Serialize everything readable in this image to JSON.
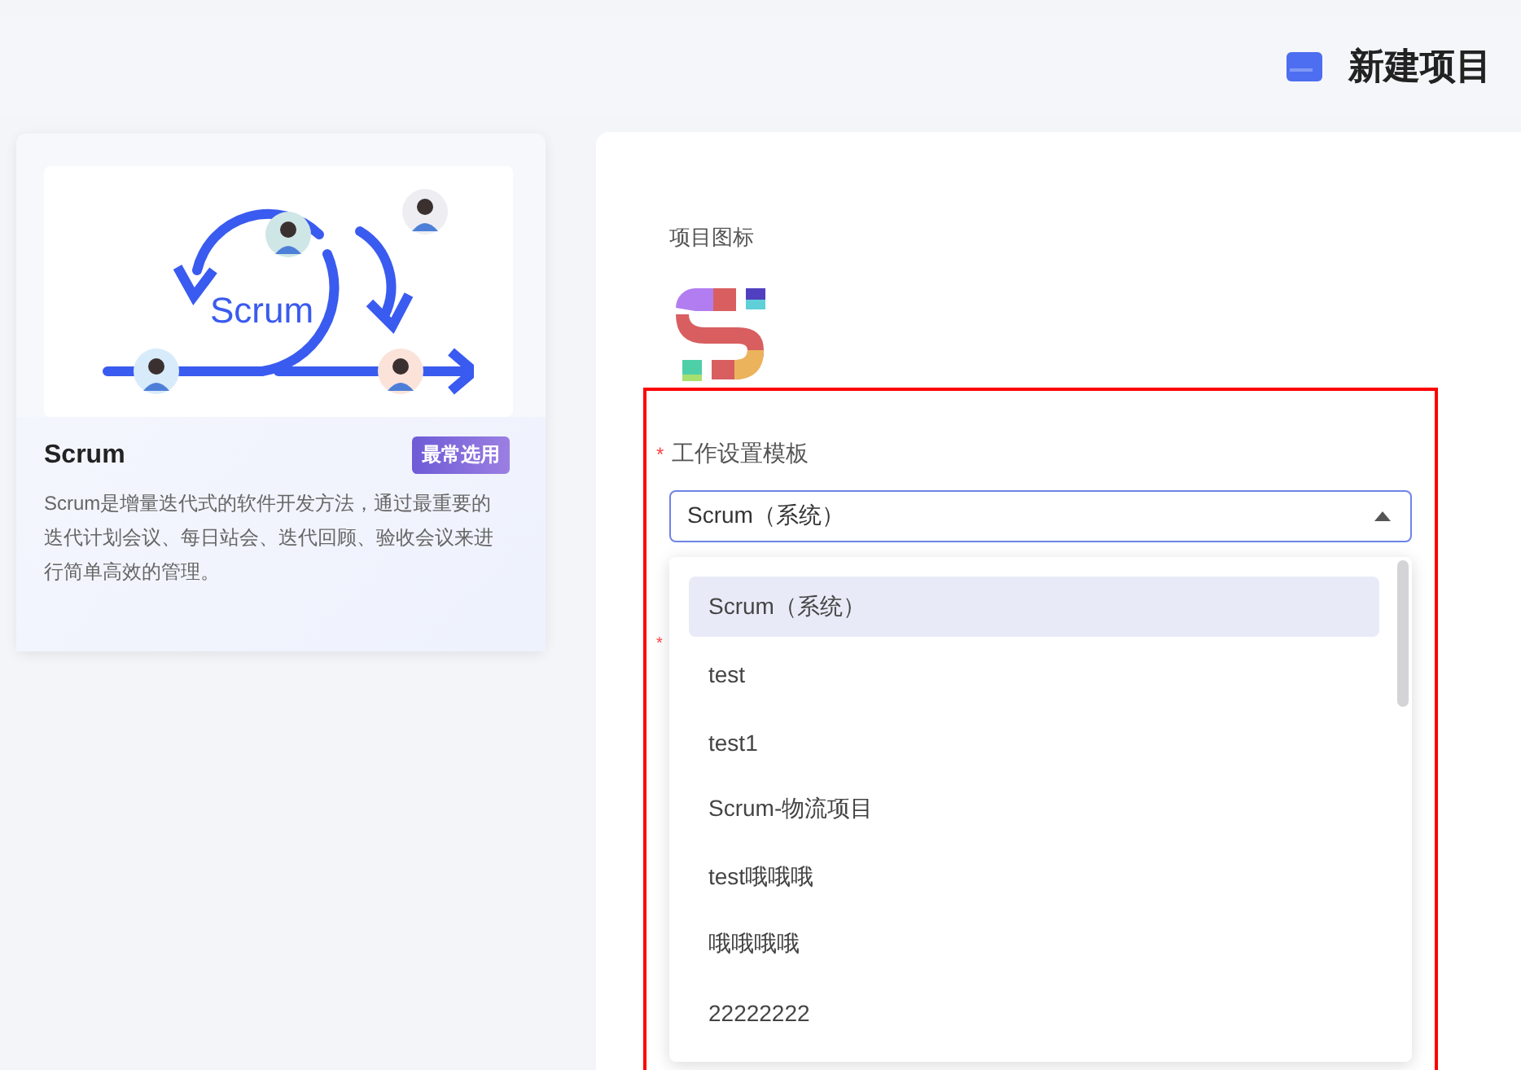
{
  "header": {
    "title": "新建项目"
  },
  "template_card": {
    "illustration_label": "Scrum",
    "name": "Scrum",
    "badge": "最常选用",
    "description": "Scrum是增量迭代式的软件开发方法，通过最重要的迭代计划会议、每日站会、迭代回顾、验收会议来进行简单高效的管理。"
  },
  "form": {
    "icon_label": "项目图标",
    "template_field": {
      "required": true,
      "label": "工作设置模板",
      "value": "Scrum（系统）",
      "expanded": true
    },
    "hidden_required_mark": "*",
    "options": [
      {
        "label": "Scrum（系统）",
        "selected": true
      },
      {
        "label": "test",
        "selected": false
      },
      {
        "label": "test1",
        "selected": false
      },
      {
        "label": "Scrum-物流项目",
        "selected": false
      },
      {
        "label": "test哦哦哦",
        "selected": false
      },
      {
        "label": "哦哦哦哦",
        "selected": false
      },
      {
        "label": "22222222",
        "selected": false
      }
    ]
  }
}
